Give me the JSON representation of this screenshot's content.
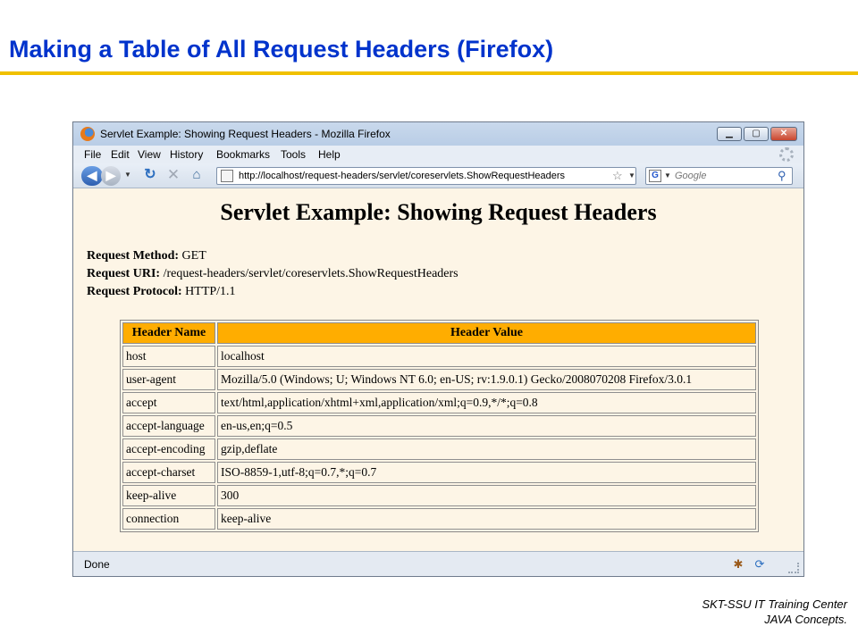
{
  "slide": {
    "title": "Making a Table of All Request Headers (Firefox)",
    "footer_line1": "SKT-SSU IT Training Center",
    "footer_line2": "JAVA Concepts."
  },
  "window": {
    "title": "Servlet Example: Showing Request Headers - Mozilla Firefox",
    "min_icon": "minimize-icon",
    "max_icon": "maximize-icon",
    "close_icon": "close-icon"
  },
  "menu": {
    "items": [
      "File",
      "Edit",
      "View",
      "History",
      "Bookmarks",
      "Tools",
      "Help"
    ]
  },
  "nav": {
    "url": "http://localhost/request-headers/servlet/coreservlets.ShowRequestHeaders",
    "search_placeholder": "Google"
  },
  "page": {
    "heading": "Servlet Example: Showing Request Headers",
    "method_label": "Request Method:",
    "method_value": "GET",
    "uri_label": "Request URI:",
    "uri_value": "/request-headers/servlet/coreservlets.ShowRequestHeaders",
    "protocol_label": "Request Protocol:",
    "protocol_value": "HTTP/1.1",
    "table": {
      "headers": [
        "Header Name",
        "Header Value"
      ],
      "rows": [
        [
          "host",
          "localhost"
        ],
        [
          "user-agent",
          "Mozilla/5.0 (Windows; U; Windows NT 6.0; en-US; rv:1.9.0.1) Gecko/2008070208 Firefox/3.0.1"
        ],
        [
          "accept",
          "text/html,application/xhtml+xml,application/xml;q=0.9,*/*;q=0.8"
        ],
        [
          "accept-language",
          "en-us,en;q=0.5"
        ],
        [
          "accept-encoding",
          "gzip,deflate"
        ],
        [
          "accept-charset",
          "ISO-8859-1,utf-8;q=0.7,*;q=0.7"
        ],
        [
          "keep-alive",
          "300"
        ],
        [
          "connection",
          "keep-alive"
        ]
      ]
    }
  },
  "status": {
    "text": "Done"
  },
  "colors": {
    "slide_title": "#0033cc",
    "rule": "#f0c000",
    "page_background": "#fdf5e6",
    "table_header": "#ffad00"
  }
}
